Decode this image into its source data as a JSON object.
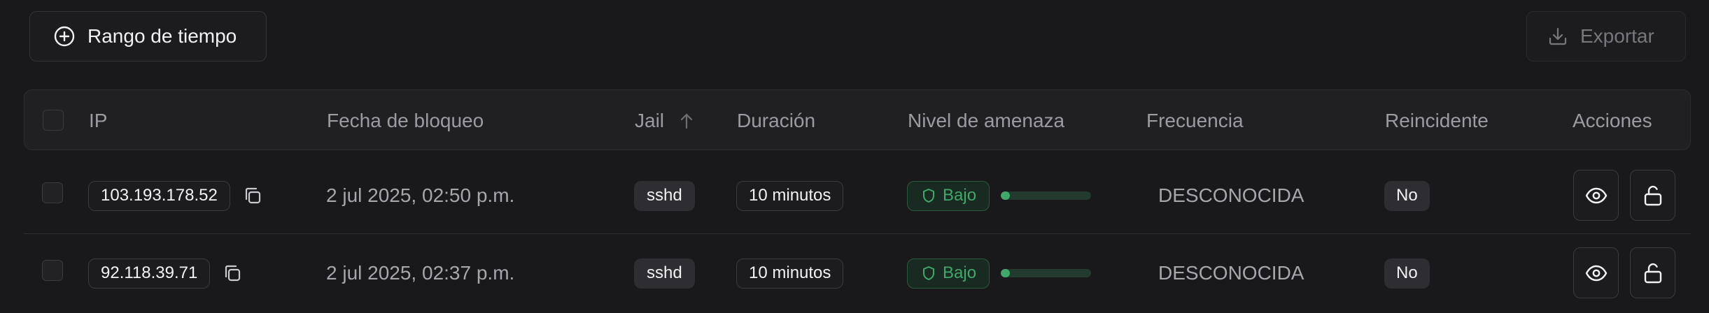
{
  "toolbar": {
    "range_label": "Rango de tiempo",
    "export_label": "Exportar"
  },
  "table": {
    "columns": {
      "ip": "IP",
      "blocked_at": "Fecha de bloqueo",
      "jail": "Jail",
      "duration": "Duración",
      "threat": "Nivel de amenaza",
      "frequency": "Frecuencia",
      "repeat": "Reincidente",
      "actions": "Acciones"
    },
    "sort": {
      "column": "Jail",
      "direction": "ascending"
    },
    "rows": [
      {
        "ip": "103.193.178.52",
        "blocked_at": "2 jul 2025, 02:50 p.m.",
        "jail": "sshd",
        "duration": "10 minutos",
        "threat": "Bajo",
        "threat_level": 0.1,
        "frequency": "DESCONOCIDA",
        "repeat": "No"
      },
      {
        "ip": "92.118.39.71",
        "blocked_at": "2 jul 2025, 02:37 p.m.",
        "jail": "sshd",
        "duration": "10 minutos",
        "threat": "Bajo",
        "threat_level": 0.1,
        "frequency": "DESCONOCIDA",
        "repeat": "No"
      }
    ]
  },
  "icons": {
    "range": "plus-circle-icon",
    "export": "download-icon",
    "sort": "arrow-up-icon",
    "copy": "copy-icon",
    "threat": "shield-icon",
    "view": "eye-icon",
    "unblock": "unlock-icon"
  },
  "colors": {
    "background": "#19191b",
    "threat_low": "#3fa86a",
    "threat_low_track": "#233a2e"
  }
}
